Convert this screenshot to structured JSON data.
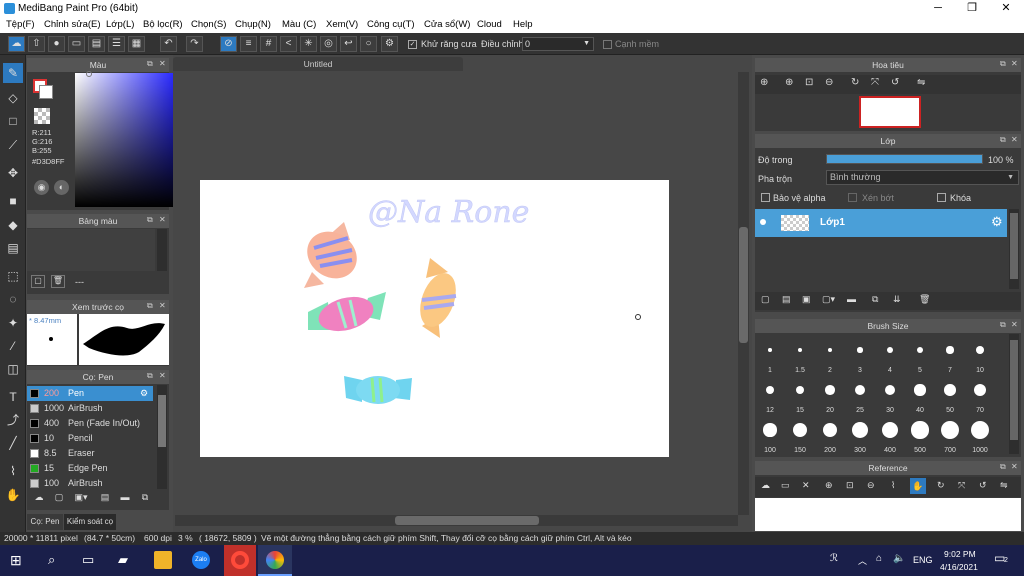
{
  "window": {
    "title": "MediBang Paint Pro (64bit)",
    "minimize": "─",
    "maximize": "❐",
    "close": "✕"
  },
  "menu": [
    "Tệp(F)",
    "Chỉnh sửa(E)",
    "Lớp(L)",
    "Bộ lọc(R)",
    "Chọn(S)",
    "Chụp(N)",
    "Màu (C)",
    "Xem(V)",
    "Công cụ(T)",
    "Cửa sổ(W)",
    "Cloud",
    "Help"
  ],
  "toolbar": {
    "antialias_label": "Khử răng cưa",
    "correction_label": "Điều chỉnh",
    "correction_value": "0",
    "edge_label": "Cạnh mềm"
  },
  "color_panel": {
    "title": "Màu",
    "r": "R:211",
    "g": "G:216",
    "b": "B:255",
    "hex": "#D3D8FF"
  },
  "palette_panel": {
    "title": "Bảng màu",
    "dash": "---"
  },
  "brush_preview": {
    "title": "Xem trước cọ",
    "size": "* 8.47mm"
  },
  "brush_panel": {
    "title": "Cọ: Pen",
    "items": [
      {
        "size": "200",
        "name": "Pen",
        "color": "#000000",
        "selected": true
      },
      {
        "size": "1000",
        "name": "AirBrush",
        "color": "#cccccc"
      },
      {
        "size": "400",
        "name": "Pen (Fade In/Out)",
        "color": "#000000"
      },
      {
        "size": "10",
        "name": "Pencil",
        "color": "#000000"
      },
      {
        "size": "8.5",
        "name": "Eraser",
        "color": "#ffffff"
      },
      {
        "size": "15",
        "name": "Edge Pen",
        "color": "#22aa22"
      },
      {
        "size": "100",
        "name": "AirBrush",
        "color": "#cccccc"
      }
    ],
    "tab1": "Cọ: Pen",
    "tab2": "Kiểm soát cọ"
  },
  "canvas": {
    "tab_title": "Untitled",
    "signature": "@Na Rone"
  },
  "navigator": {
    "title": "Hoa tiêu"
  },
  "layer_panel": {
    "title": "Lớp",
    "opacity_label": "Độ trong",
    "opacity_value": "100 %",
    "opacity": 1.0,
    "blend_label": "Pha trộn",
    "blend_value": "Bình thường",
    "protect_alpha": "Bảo vệ alpha",
    "clip": "Xén bớt",
    "lock": "Khóa",
    "layer_name": "Lớp1"
  },
  "brush_size_panel": {
    "title": "Brush Size",
    "sizes": [
      "1",
      "1.5",
      "2",
      "3",
      "4",
      "5",
      "7",
      "10",
      "12",
      "15",
      "20",
      "25",
      "30",
      "40",
      "50",
      "70",
      "100",
      "150",
      "200",
      "300",
      "400",
      "500",
      "700",
      "1000"
    ]
  },
  "reference_panel": {
    "title": "Reference"
  },
  "status": {
    "dimensions": "20000 * 11811 pixel",
    "cm": "(84.7 * 50cm)",
    "dpi": "600 dpi",
    "zoom": "3 %",
    "coords": "( 18672, 5809 )",
    "hint": "Vẽ một đường thẳng bằng cách giữ phím Shift, Thay đổi cỡ cọ bằng cách giữ phím Ctrl, Alt và kéo"
  },
  "taskbar": {
    "lang": "ENG",
    "time": "9:02 PM",
    "date": "4/16/2021",
    "notif": "2"
  },
  "colors": {
    "accent": "#4a9fd8",
    "selected_row": "#3a8fd0",
    "taskbar": "#1a1f4a",
    "paint_color": "#D3D8FF"
  }
}
